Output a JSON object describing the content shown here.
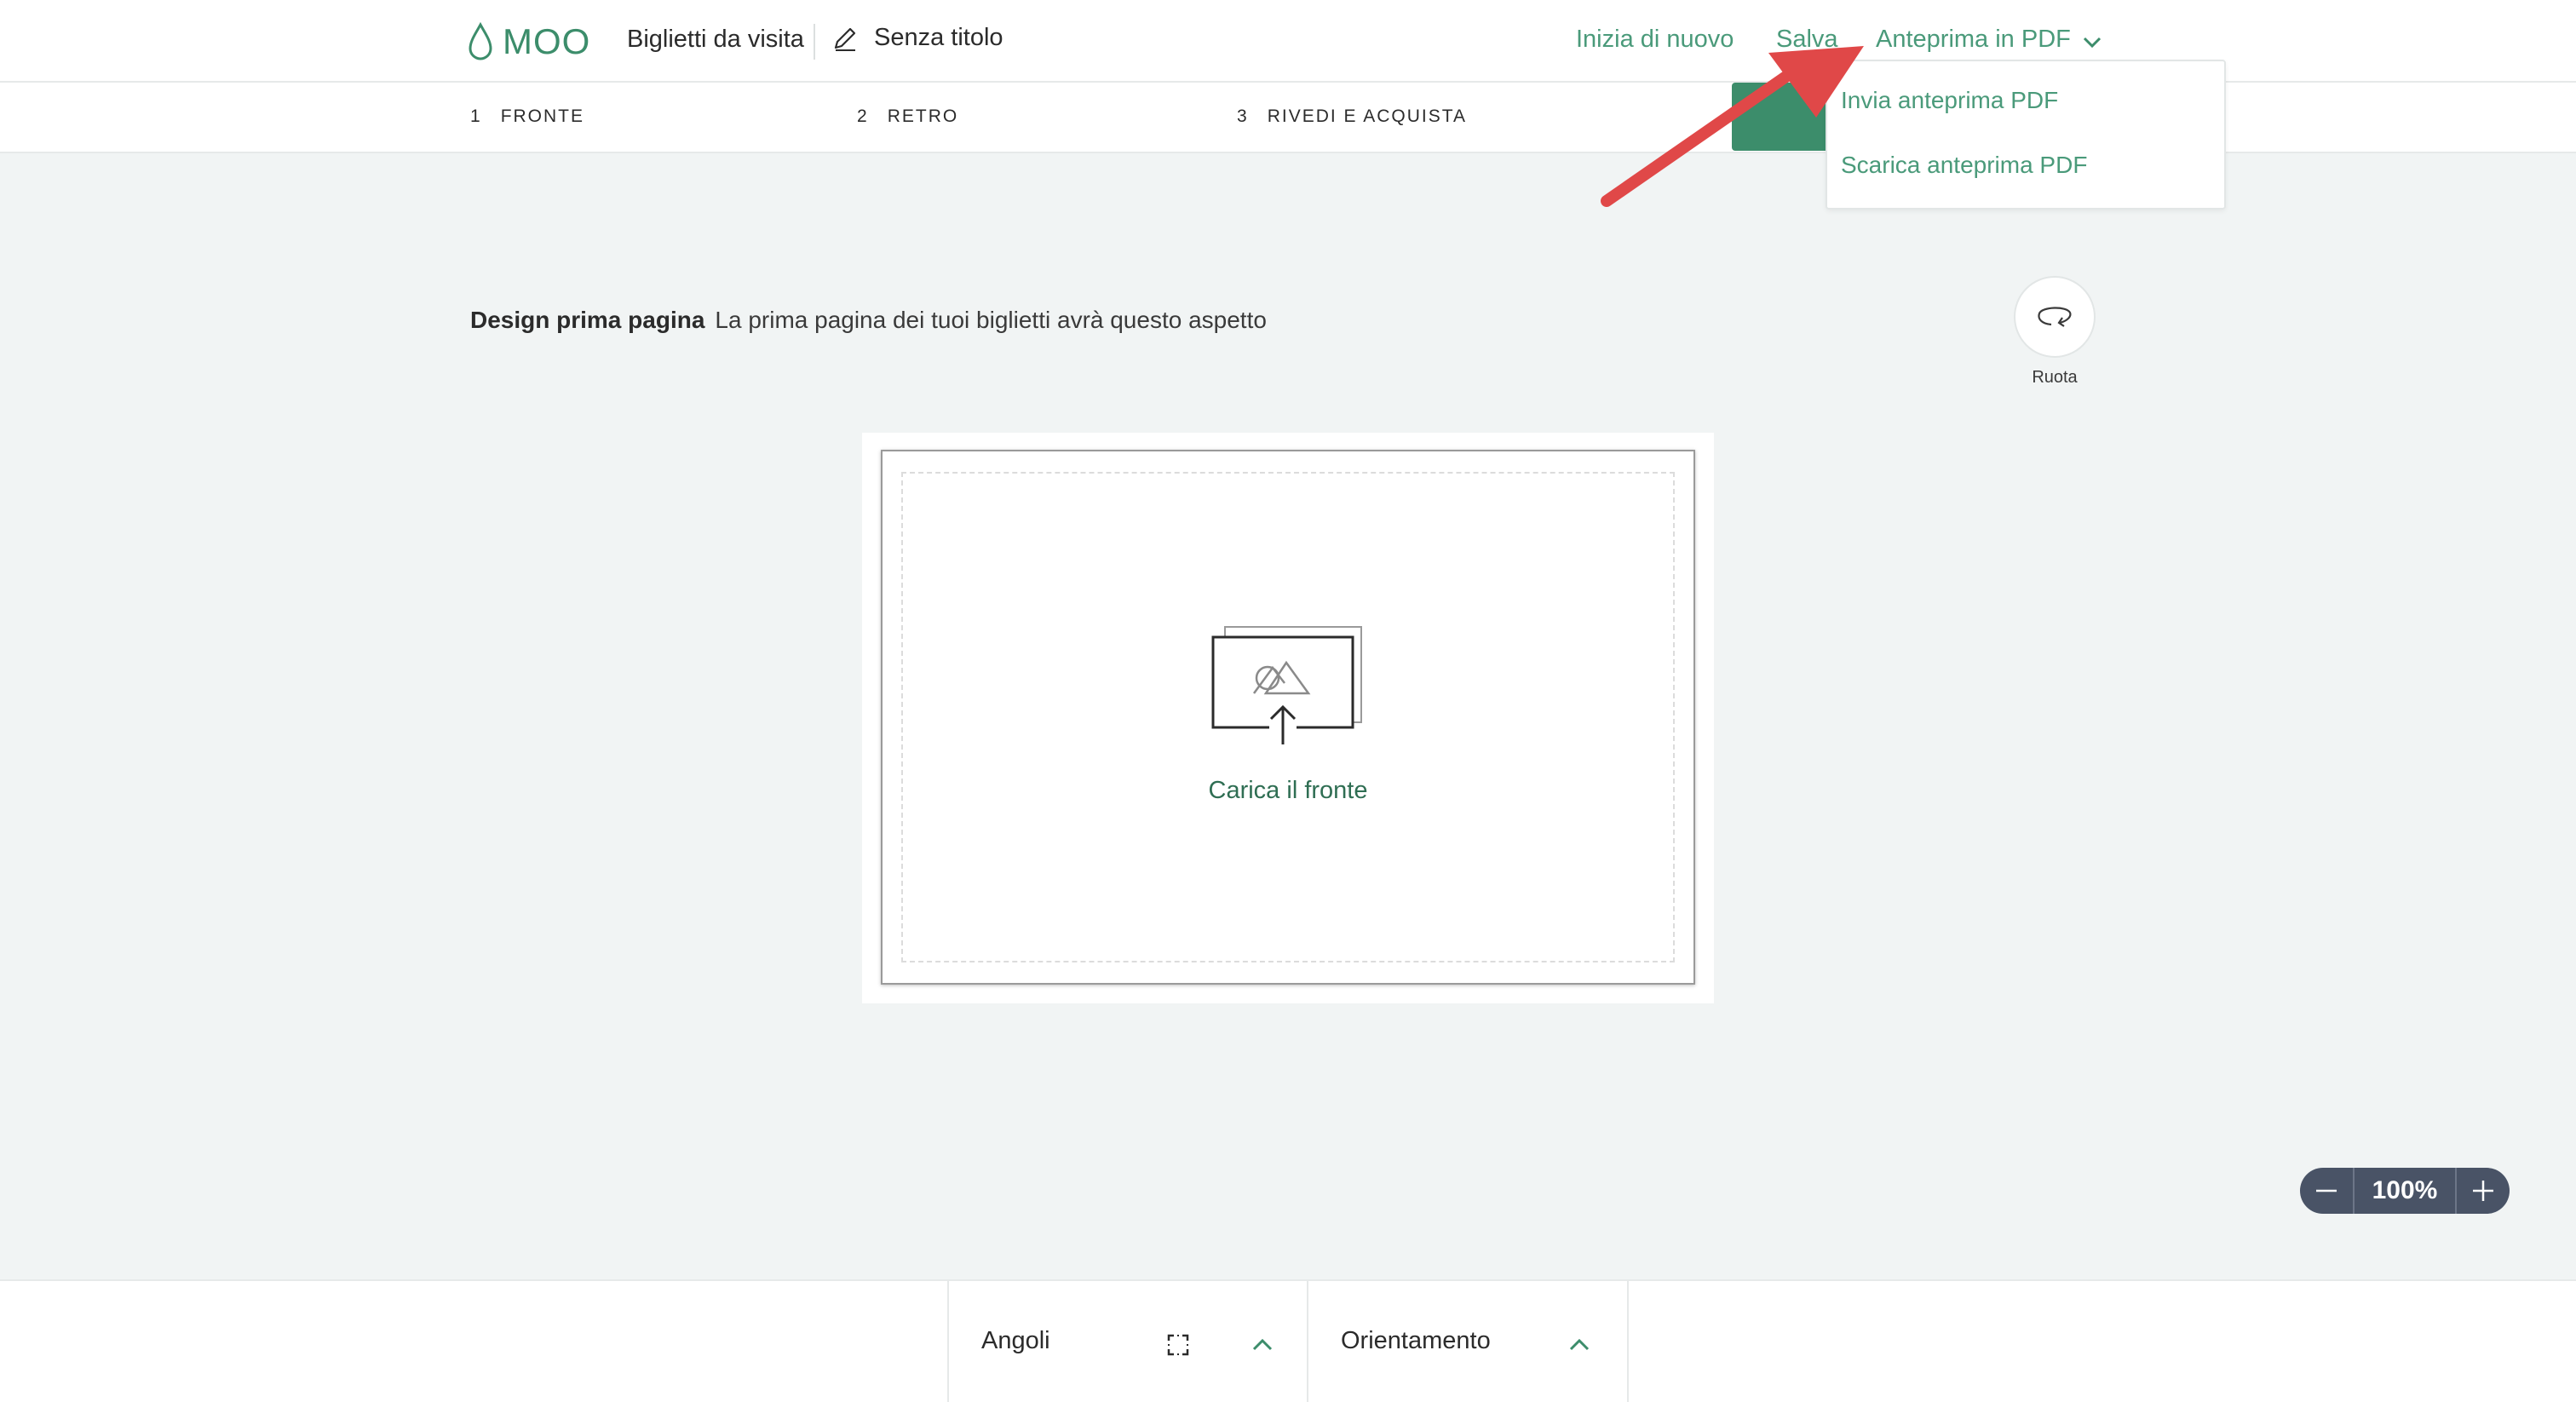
{
  "header": {
    "logo_text": "MOO",
    "product": "Biglietti da visita",
    "doc_title": "Senza titolo",
    "restart_label": "Inizia di nuovo",
    "save_label": "Salva",
    "pdf_preview_label": "Anteprima in PDF"
  },
  "dropdown": {
    "items": [
      {
        "label": "Invia anteprima PDF"
      },
      {
        "label": "Scarica anteprima PDF"
      }
    ]
  },
  "steps": [
    {
      "number": "1",
      "label": "FRONTE"
    },
    {
      "number": "2",
      "label": "RETRO"
    },
    {
      "number": "3",
      "label": "RIVEDI E ACQUISTA"
    }
  ],
  "main": {
    "heading_bold": "Design prima pagina",
    "heading_desc": "La prima pagina dei tuoi biglietti avrà questo aspetto",
    "rotate_label": "Ruota",
    "upload_label": "Carica il fronte"
  },
  "zoom": {
    "value": "100%"
  },
  "toolbar": {
    "corners_label": "Angoli",
    "orientation_label": "Orientamento"
  },
  "colors": {
    "brand_green": "#3c8d6b",
    "link_green": "#4a9a7a",
    "annotation_red": "#e04848",
    "zoom_bg": "#495366"
  }
}
